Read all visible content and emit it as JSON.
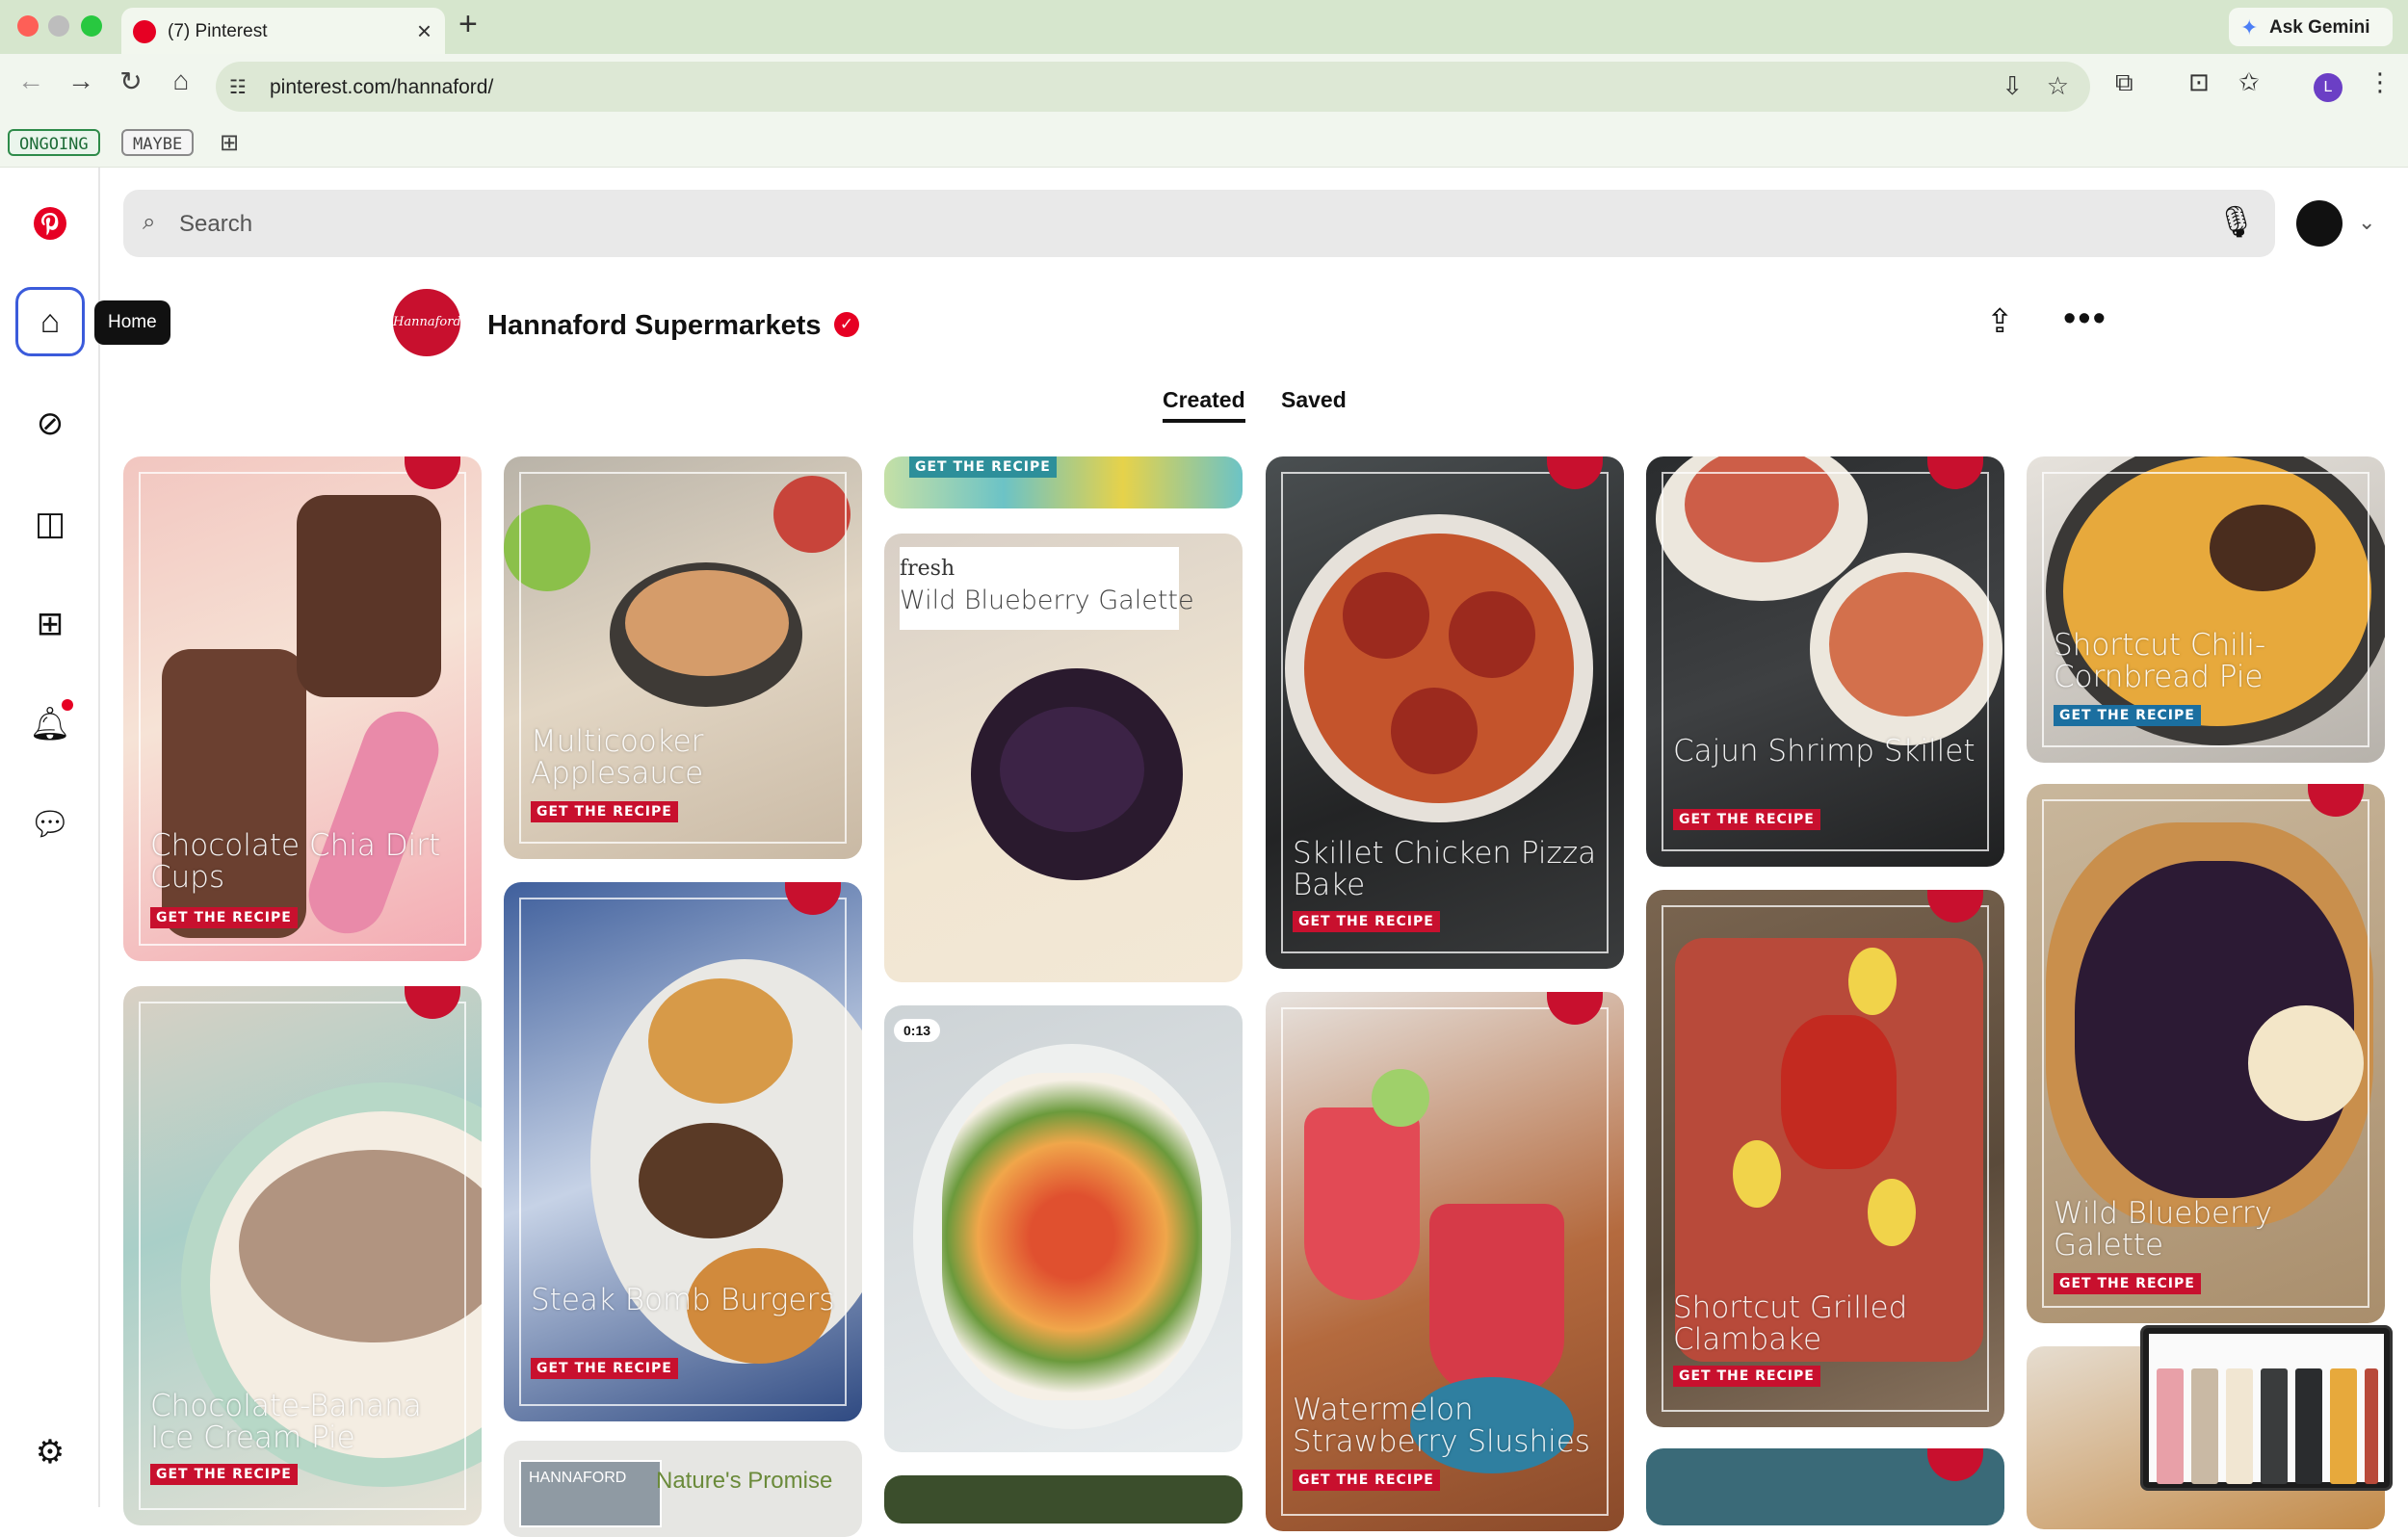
{
  "browser": {
    "tab_title": "(7) Pinterest",
    "url": "pinterest.com/hannaford/",
    "ask_gemini": "Ask Gemini",
    "profile_initial": "L",
    "bookmarks": [
      "ONGOING",
      "MAYBE"
    ]
  },
  "sidebar": {
    "tooltip": "Home",
    "items": [
      "pinterest-logo",
      "home",
      "explore",
      "boards",
      "create",
      "notifications",
      "messages",
      "settings"
    ]
  },
  "search": {
    "placeholder": "Search"
  },
  "profile": {
    "name": "Hannaford Supermarkets",
    "logo_text": "Hannaford",
    "verified": true,
    "tabs": [
      "Created",
      "Saved"
    ],
    "active_tab": "Created"
  },
  "pins": [
    {
      "title": "Chocolate Chia Dirt Cups",
      "cta": "GET THE RECIPE"
    },
    {
      "title": "Chocolate-Banana Ice Cream Pie",
      "cta": "GET THE RECIPE"
    },
    {
      "title": "Multicooker Applesauce",
      "cta": "GET THE RECIPE"
    },
    {
      "title": "Steak Bomb Burgers",
      "cta": "GET THE RECIPE"
    },
    {
      "title": "Nature's Promise",
      "brand": "HANNAFORD"
    },
    {
      "title": "",
      "cta": "GET THE RECIPE"
    },
    {
      "title": "Wild Blueberry Galette",
      "brand": "fresh"
    },
    {
      "title": "",
      "video_duration": "0:13"
    },
    {
      "title": "Skillet Chicken Pizza Bake",
      "cta": "GET THE RECIPE"
    },
    {
      "title": "Watermelon Strawberry Slushies",
      "cta": "GET THE RECIPE"
    },
    {
      "title": "Cajun Shrimp Skillet",
      "cta": "GET THE RECIPE"
    },
    {
      "title": "Shortcut Grilled Clambake",
      "cta": "GET THE RECIPE"
    },
    {
      "title": "Shortcut Chili-Cornbread Pie",
      "cta": "GET THE RECIPE"
    },
    {
      "title": "Wild Blueberry Galette",
      "cta": "GET THE RECIPE"
    }
  ],
  "colors": {
    "pinterest_red": "#e60023",
    "hannaford_red": "#c8102e",
    "chrome_green": "#d6e6cd"
  }
}
